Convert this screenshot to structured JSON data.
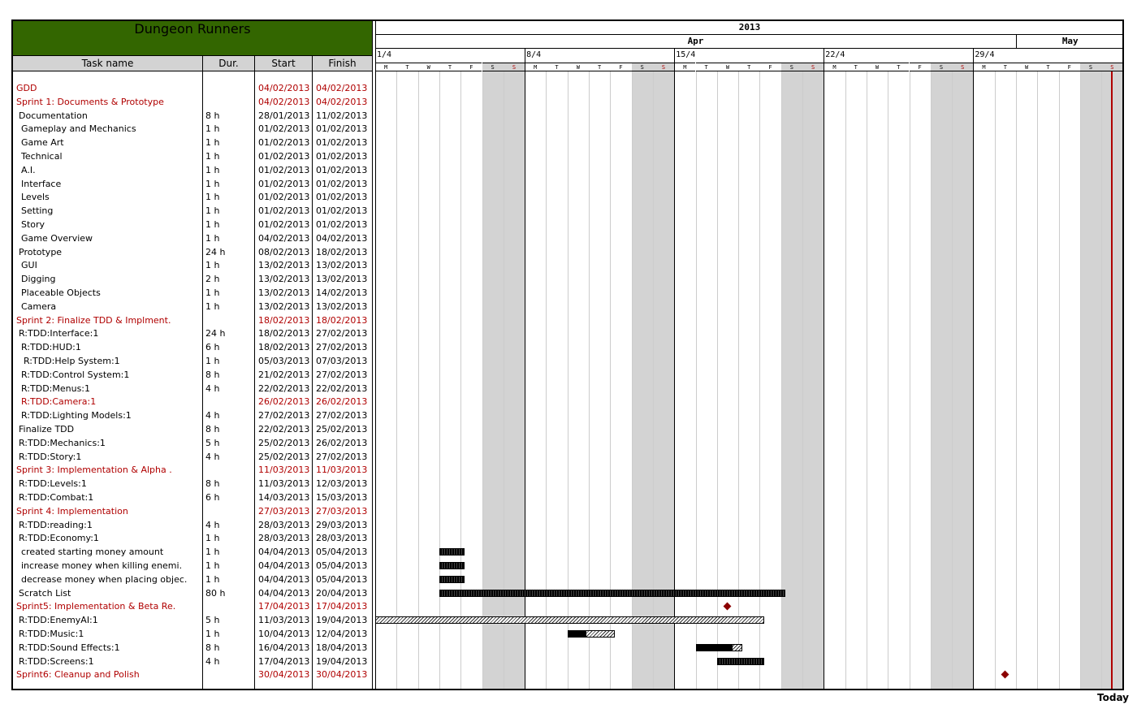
{
  "project_title": "Dungeon Runners",
  "columns": {
    "name": "Task name",
    "dur": "Dur.",
    "start": "Start",
    "finish": "Finish"
  },
  "year": "2013",
  "months": [
    {
      "label": "Apr",
      "days": 30
    },
    {
      "label": "May",
      "days": 5
    }
  ],
  "weeks": [
    "1/4",
    "8/4",
    "15/4",
    "22/4",
    "29/4"
  ],
  "day_letters": [
    "M",
    "T",
    "W",
    "T",
    "F",
    "S",
    "S"
  ],
  "today_label": "Today",
  "today_day_index": 34,
  "colors": {
    "title_bg": "#336600",
    "milestone": "#8b0000",
    "today": "#b00000",
    "weekend": "#d3d3d3"
  },
  "tasks": [
    {
      "name": "GDD",
      "dur": "",
      "start": "04/02/2013",
      "finish": "04/02/2013",
      "red": true,
      "indent": 0
    },
    {
      "name": "Sprint 1: Documents & Prototype",
      "dur": "",
      "start": "04/02/2013",
      "finish": "04/02/2013",
      "red": true,
      "indent": 0
    },
    {
      "name": "Documentation",
      "dur": "8 h",
      "start": "28/01/2013",
      "finish": "11/02/2013",
      "red": false,
      "indent": 1
    },
    {
      "name": "Gameplay and Mechanics",
      "dur": "1 h",
      "start": "01/02/2013",
      "finish": "01/02/2013",
      "red": false,
      "indent": 2
    },
    {
      "name": "Game Art",
      "dur": "1 h",
      "start": "01/02/2013",
      "finish": "01/02/2013",
      "red": false,
      "indent": 2
    },
    {
      "name": "Technical",
      "dur": "1 h",
      "start": "01/02/2013",
      "finish": "01/02/2013",
      "red": false,
      "indent": 2
    },
    {
      "name": "A.I.",
      "dur": "1 h",
      "start": "01/02/2013",
      "finish": "01/02/2013",
      "red": false,
      "indent": 2
    },
    {
      "name": "Interface",
      "dur": "1 h",
      "start": "01/02/2013",
      "finish": "01/02/2013",
      "red": false,
      "indent": 2
    },
    {
      "name": "Levels",
      "dur": "1 h",
      "start": "01/02/2013",
      "finish": "01/02/2013",
      "red": false,
      "indent": 2
    },
    {
      "name": "Setting",
      "dur": "1 h",
      "start": "01/02/2013",
      "finish": "01/02/2013",
      "red": false,
      "indent": 2
    },
    {
      "name": "Story",
      "dur": "1 h",
      "start": "01/02/2013",
      "finish": "01/02/2013",
      "red": false,
      "indent": 2
    },
    {
      "name": "Game Overview",
      "dur": "1 h",
      "start": "04/02/2013",
      "finish": "04/02/2013",
      "red": false,
      "indent": 2
    },
    {
      "name": "Prototype",
      "dur": "24 h",
      "start": "08/02/2013",
      "finish": "18/02/2013",
      "red": false,
      "indent": 1
    },
    {
      "name": "GUI",
      "dur": "1 h",
      "start": "13/02/2013",
      "finish": "13/02/2013",
      "red": false,
      "indent": 2
    },
    {
      "name": "Digging",
      "dur": "2 h",
      "start": "13/02/2013",
      "finish": "13/02/2013",
      "red": false,
      "indent": 2
    },
    {
      "name": "Placeable Objects",
      "dur": "1 h",
      "start": "13/02/2013",
      "finish": "14/02/2013",
      "red": false,
      "indent": 2
    },
    {
      "name": "Camera",
      "dur": "1 h",
      "start": "13/02/2013",
      "finish": "13/02/2013",
      "red": false,
      "indent": 2
    },
    {
      "name": "Sprint 2: Finalize TDD & Implment.",
      "dur": "",
      "start": "18/02/2013",
      "finish": "18/02/2013",
      "red": true,
      "indent": 0
    },
    {
      "name": "R:TDD:Interface:1",
      "dur": "24 h",
      "start": "18/02/2013",
      "finish": "27/02/2013",
      "red": false,
      "indent": 1
    },
    {
      "name": "R:TDD:HUD:1",
      "dur": "6 h",
      "start": "18/02/2013",
      "finish": "27/02/2013",
      "red": false,
      "indent": 2
    },
    {
      "name": "R:TDD:Help System:1",
      "dur": "1 h",
      "start": "05/03/2013",
      "finish": "07/03/2013",
      "red": false,
      "indent": 3
    },
    {
      "name": "R:TDD:Control System:1",
      "dur": "8 h",
      "start": "21/02/2013",
      "finish": "27/02/2013",
      "red": false,
      "indent": 2
    },
    {
      "name": "R:TDD:Menus:1",
      "dur": "4 h",
      "start": "22/02/2013",
      "finish": "22/02/2013",
      "red": false,
      "indent": 2
    },
    {
      "name": "R:TDD:Camera:1",
      "dur": "",
      "start": "26/02/2013",
      "finish": "26/02/2013",
      "red": true,
      "indent": 2
    },
    {
      "name": "R:TDD:Lighting Models:1",
      "dur": "4 h",
      "start": "27/02/2013",
      "finish": "27/02/2013",
      "red": false,
      "indent": 2
    },
    {
      "name": "Finalize TDD",
      "dur": "8 h",
      "start": "22/02/2013",
      "finish": "25/02/2013",
      "red": false,
      "indent": 1
    },
    {
      "name": "R:TDD:Mechanics:1",
      "dur": "5 h",
      "start": "25/02/2013",
      "finish": "26/02/2013",
      "red": false,
      "indent": 1
    },
    {
      "name": "R:TDD:Story:1",
      "dur": "4 h",
      "start": "25/02/2013",
      "finish": "27/02/2013",
      "red": false,
      "indent": 1
    },
    {
      "name": "Sprint 3: Implementation & Alpha .",
      "dur": "",
      "start": "11/03/2013",
      "finish": "11/03/2013",
      "red": true,
      "indent": 0
    },
    {
      "name": "R:TDD:Levels:1",
      "dur": "8 h",
      "start": "11/03/2013",
      "finish": "12/03/2013",
      "red": false,
      "indent": 1
    },
    {
      "name": "R:TDD:Combat:1",
      "dur": "6 h",
      "start": "14/03/2013",
      "finish": "15/03/2013",
      "red": false,
      "indent": 1
    },
    {
      "name": "Sprint 4: Implementation",
      "dur": "",
      "start": "27/03/2013",
      "finish": "27/03/2013",
      "red": true,
      "indent": 0
    },
    {
      "name": "R:TDD:reading:1",
      "dur": "4 h",
      "start": "28/03/2013",
      "finish": "29/03/2013",
      "red": false,
      "indent": 1
    },
    {
      "name": "R:TDD:Economy:1",
      "dur": "1 h",
      "start": "28/03/2013",
      "finish": "28/03/2013",
      "red": false,
      "indent": 1
    },
    {
      "name": "created starting money amount",
      "dur": "1 h",
      "start": "04/04/2013",
      "finish": "05/04/2013",
      "red": false,
      "indent": 2
    },
    {
      "name": "increase money when killing enemi.",
      "dur": "1 h",
      "start": "04/04/2013",
      "finish": "05/04/2013",
      "red": false,
      "indent": 2
    },
    {
      "name": "decrease money when placing objec.",
      "dur": "1 h",
      "start": "04/04/2013",
      "finish": "05/04/2013",
      "red": false,
      "indent": 2
    },
    {
      "name": "Scratch List",
      "dur": "80 h",
      "start": "04/04/2013",
      "finish": "20/04/2013",
      "red": false,
      "indent": 1
    },
    {
      "name": "Sprint5: Implementation & Beta Re.",
      "dur": "",
      "start": "17/04/2013",
      "finish": "17/04/2013",
      "red": true,
      "indent": 0
    },
    {
      "name": "R:TDD:EnemyAI:1",
      "dur": "5 h",
      "start": "11/03/2013",
      "finish": "19/04/2013",
      "red": false,
      "indent": 1
    },
    {
      "name": "R:TDD:Music:1",
      "dur": "1 h",
      "start": "10/04/2013",
      "finish": "12/04/2013",
      "red": false,
      "indent": 1
    },
    {
      "name": "R:TDD:Sound Effects:1",
      "dur": "8 h",
      "start": "16/04/2013",
      "finish": "18/04/2013",
      "red": false,
      "indent": 1
    },
    {
      "name": "R:TDD:Screens:1",
      "dur": "4 h",
      "start": "17/04/2013",
      "finish": "19/04/2013",
      "red": false,
      "indent": 1
    },
    {
      "name": "Sprint6: Cleanup and Polish",
      "dur": "",
      "start": "30/04/2013",
      "finish": "30/04/2013",
      "red": true,
      "indent": 0
    }
  ],
  "bars": [
    {
      "row": 34,
      "start": "04/04/2013",
      "end": "05/04/2013",
      "hatch": false,
      "progress": 1.0
    },
    {
      "row": 35,
      "start": "04/04/2013",
      "end": "05/04/2013",
      "hatch": false,
      "progress": 1.0
    },
    {
      "row": 36,
      "start": "04/04/2013",
      "end": "05/04/2013",
      "hatch": false,
      "progress": 1.0
    },
    {
      "row": 37,
      "start": "04/04/2013",
      "end": "20/04/2013",
      "hatch": false,
      "progress": 1.0
    },
    {
      "row": 39,
      "start": "01/04/2013",
      "end": "19/04/2013",
      "hatch": true,
      "progress": 0
    },
    {
      "row": 40,
      "start": "10/04/2013",
      "end": "12/04/2013",
      "hatch": true,
      "progress": 0.4
    },
    {
      "row": 41,
      "start": "16/04/2013",
      "end": "18/04/2013",
      "hatch": true,
      "progress": 0.8
    },
    {
      "row": 42,
      "start": "17/04/2013",
      "end": "19/04/2013",
      "hatch": false,
      "progress": 1.0
    }
  ],
  "milestones": [
    {
      "row": 38,
      "date": "17/04/2013"
    },
    {
      "row": 43,
      "date": "30/04/2013"
    }
  ]
}
